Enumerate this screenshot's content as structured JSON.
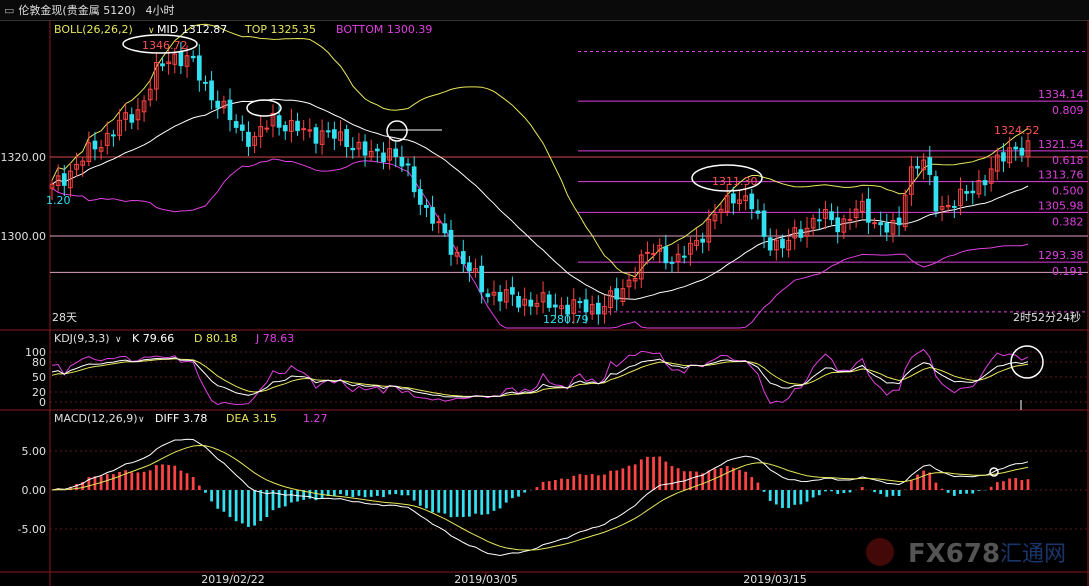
{
  "window": {
    "title": "伦敦金现(贵金属 5120)",
    "period": "4小时"
  },
  "boll_header": {
    "name": "BOLL(26,26,2)",
    "mid": "MID 1312.87",
    "top": "TOP 1325.35",
    "bottom": "BOTTOM 1300.39"
  },
  "kdj_header": {
    "name": "KDJ(9,3,3)",
    "k": "K 79.66",
    "d": "D 80.18",
    "j": "J 78.63"
  },
  "macd_header": {
    "name": "MACD(12,26,9)",
    "diff": "DIFF 3.78",
    "dea": "DEA 3.15",
    "macd": "1.27"
  },
  "main_labels": {
    "left_edge_value": "1.20",
    "days": "28天",
    "countdown": "2时52分24秒",
    "low_label": "1280.79",
    "high_label": "1346.72",
    "mid_label": "1311.30",
    "last_label": "1324.52"
  },
  "price_axis": {
    "ticks": [
      "1320.00",
      "1300.00"
    ],
    "values": [
      1320,
      1300
    ]
  },
  "kdj_axis": [
    "100",
    "80",
    "50",
    "20",
    "0"
  ],
  "macd_axis": [
    "5.00",
    "0.00",
    "-5.00"
  ],
  "date_labels": [
    "2019/02/22",
    "2019/03/05",
    "2019/03/15"
  ],
  "fib_levels": [
    {
      "price": 1334.14,
      "label": "1334.14",
      "ratio": "0.809"
    },
    {
      "price": 1321.54,
      "label": "1321.54",
      "ratio": "0.618"
    },
    {
      "price": 1313.76,
      "label": "1313.76",
      "ratio": "0.500"
    },
    {
      "price": 1305.98,
      "label": "1305.98",
      "ratio": "0.382"
    },
    {
      "price": 1293.38,
      "label": "1293.38",
      "ratio": "0.191"
    }
  ],
  "watermark": {
    "text": "FX678",
    "cn": "汇通网"
  },
  "colors": {
    "up": "#ff4444",
    "down": "#33e0f0",
    "boll_upper": "#e6e65a",
    "boll_mid": "#ffffff",
    "boll_lower": "#e040e0",
    "fib": "#e040e0",
    "ref_red": "#d44848",
    "k_line": "#ffffff",
    "d_line": "#e6e65a",
    "j_line": "#e040e0"
  },
  "chart_data": {
    "type": "candlestick",
    "bar_count": 160,
    "price_range": [
      1272,
      1356
    ],
    "closes_pivots": [
      [
        0,
        1312
      ],
      [
        5,
        1318
      ],
      [
        12,
        1326
      ],
      [
        18,
        1332
      ],
      [
        22,
        1342
      ],
      [
        25,
        1346
      ],
      [
        29,
        1344
      ],
      [
        33,
        1336
      ],
      [
        38,
        1328
      ],
      [
        42,
        1324
      ],
      [
        46,
        1330
      ],
      [
        50,
        1327
      ],
      [
        56,
        1326
      ],
      [
        62,
        1324
      ],
      [
        66,
        1320
      ],
      [
        70,
        1322
      ],
      [
        74,
        1316
      ],
      [
        78,
        1306
      ],
      [
        84,
        1296
      ],
      [
        90,
        1286
      ],
      [
        96,
        1284
      ],
      [
        102,
        1283
      ],
      [
        108,
        1282
      ],
      [
        114,
        1282
      ],
      [
        118,
        1285
      ],
      [
        122,
        1293
      ],
      [
        126,
        1297
      ],
      [
        130,
        1293
      ],
      [
        134,
        1299
      ],
      [
        138,
        1305
      ],
      [
        142,
        1311
      ],
      [
        146,
        1307
      ],
      [
        148,
        1300
      ],
      [
        152,
        1297
      ],
      [
        156,
        1302
      ],
      [
        160,
        1305
      ],
      [
        164,
        1303
      ],
      [
        168,
        1307
      ],
      [
        172,
        1303
      ],
      [
        176,
        1301
      ],
      [
        178,
        1316
      ],
      [
        181,
        1320
      ],
      [
        184,
        1307
      ],
      [
        186,
        1308
      ],
      [
        190,
        1310
      ],
      [
        194,
        1315
      ],
      [
        198,
        1320
      ],
      [
        200,
        1323
      ],
      [
        203,
        1322
      ]
    ],
    "boll": {
      "period": 26,
      "width": 2
    },
    "kdj": {
      "params": [
        9,
        3,
        3
      ],
      "k": 79.66,
      "d": 80.18,
      "j": 78.63
    },
    "macd": {
      "params": [
        12,
        26,
        9
      ],
      "diff": 3.78,
      "dea": 3.15,
      "hist": 1.27
    }
  }
}
